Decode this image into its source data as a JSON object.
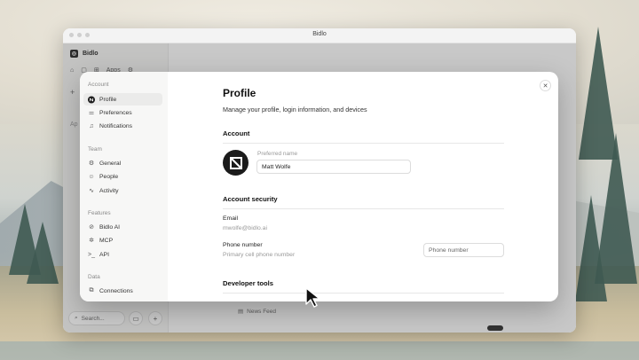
{
  "window": {
    "title": "Bidlo"
  },
  "app_sidebar": {
    "brand": "Bidlo",
    "apps_label": "Apps",
    "ap_label": "Ap",
    "search_placeholder": "Search..."
  },
  "app_main": {
    "news_feed": "News Feed"
  },
  "dialog": {
    "sections": [
      {
        "label": "Account",
        "items": [
          {
            "label": "Profile",
            "icon": "profile-icon",
            "active": true
          },
          {
            "label": "Preferences",
            "icon": "sliders-icon"
          },
          {
            "label": "Notifications",
            "icon": "bell-icon"
          }
        ]
      },
      {
        "label": "Team",
        "items": [
          {
            "label": "General",
            "icon": "gear-icon"
          },
          {
            "label": "People",
            "icon": "people-icon"
          },
          {
            "label": "Activity",
            "icon": "activity-icon"
          }
        ]
      },
      {
        "label": "Features",
        "items": [
          {
            "label": "Bidlo AI",
            "icon": "ai-icon"
          },
          {
            "label": "MCP",
            "icon": "mcp-icon"
          },
          {
            "label": "API",
            "icon": "terminal-icon"
          }
        ]
      },
      {
        "label": "Data",
        "items": [
          {
            "label": "Connections",
            "icon": "connections-icon"
          }
        ]
      }
    ],
    "profile": {
      "title": "Profile",
      "subtitle": "Manage your profile, login information, and devices",
      "account_heading": "Account",
      "preferred_name_label": "Preferred name",
      "preferred_name_value": "Matt Wolfe",
      "security_heading": "Account security",
      "email_label": "Email",
      "email_value": "mwolfe@bidlo.ai",
      "phone_label": "Phone number",
      "phone_hint": "Primary cell phone number",
      "phone_placeholder": "Phone number",
      "dev_heading": "Developer tools"
    }
  }
}
